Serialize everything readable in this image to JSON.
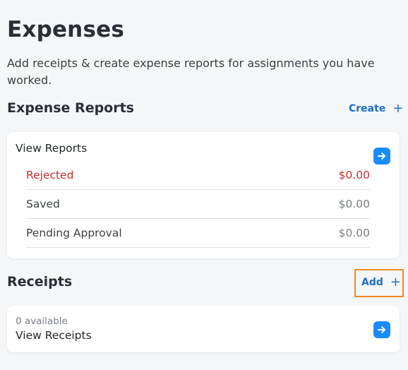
{
  "page": {
    "title": "Expenses",
    "subtitle": "Add receipts & create expense reports for assignments you have worked."
  },
  "expense_reports": {
    "title": "Expense Reports",
    "create_label": "Create",
    "plus_glyph": "+",
    "card_heading": "View Reports",
    "rows": [
      {
        "label": "Rejected",
        "value": "$0.00",
        "status_color": "#c62f2f"
      },
      {
        "label": "Saved",
        "value": "$0.00"
      },
      {
        "label": "Pending Approval",
        "value": "$0.00"
      }
    ]
  },
  "receipts": {
    "title": "Receipts",
    "add_label": "Add",
    "plus_glyph": "+",
    "available_text": "0 available",
    "card_heading": "View Receipts"
  },
  "icons": {
    "arrow": "arrow-right-icon"
  },
  "colors": {
    "accent": "#1a8cff",
    "link": "#1f6fc5",
    "rejected": "#c62f2f",
    "highlight": "#f08a24"
  }
}
